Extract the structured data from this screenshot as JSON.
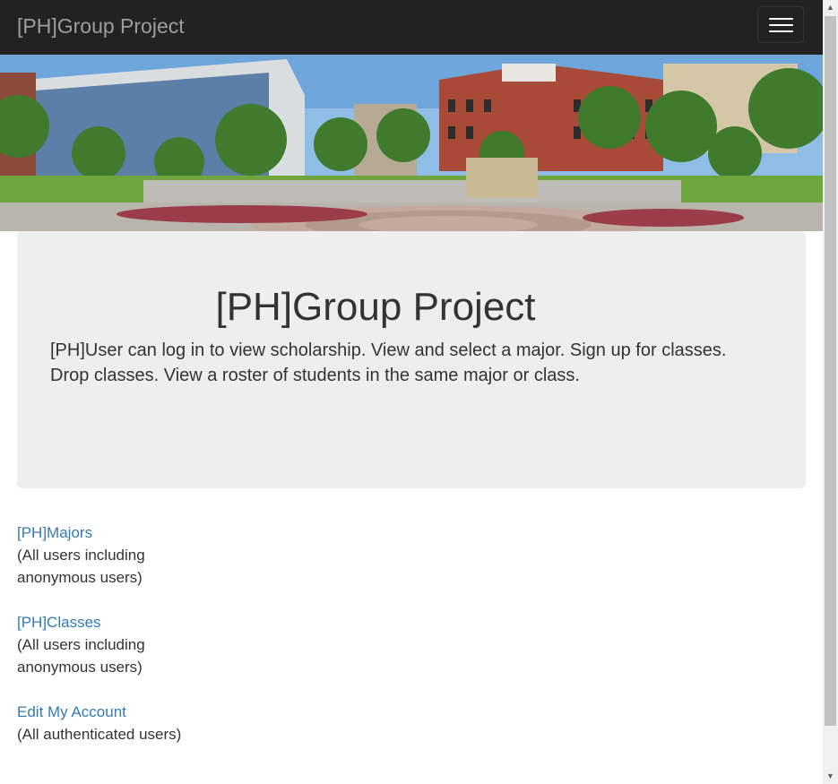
{
  "navbar": {
    "brand": "[PH]Group Project",
    "toggle_icon": "hamburger-menu-icon"
  },
  "banner": {
    "image": "campus-photo"
  },
  "jumbotron": {
    "title": "[PH]Group Project",
    "description": "[PH]User can log in to view scholarship. View and select a major. Sign up for classes. Drop classes. View a roster of students in the same major or class."
  },
  "links": [
    {
      "label": "[PH]Majors",
      "note": "(All users including anonymous users)"
    },
    {
      "label": "[PH]Classes",
      "note": "(All users including anonymous users)"
    },
    {
      "label": "Edit My Account",
      "note": "(All authenticated users)"
    }
  ],
  "colors": {
    "navbar_bg": "#222222",
    "brand": "#9d9d9d",
    "link": "#337ab7",
    "jumbotron_bg": "#eeeeee"
  },
  "scrollbar": {
    "up_icon": "▲",
    "down_icon": "▼"
  }
}
